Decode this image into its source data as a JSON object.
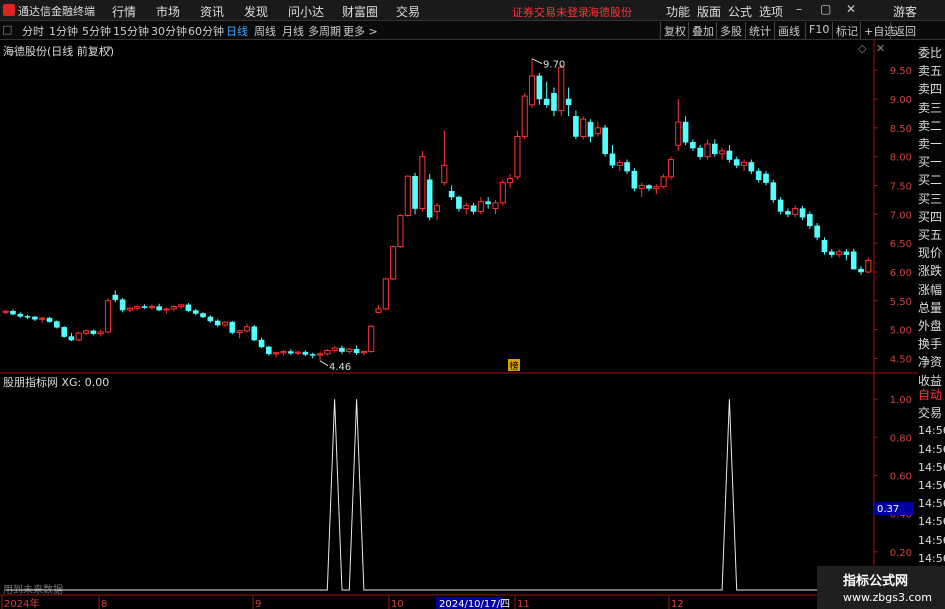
{
  "app": {
    "title": "通达信金融终端",
    "menus": [
      "行情",
      "市场",
      "资讯",
      "发现",
      "问小达",
      "财富圈",
      "交易"
    ],
    "warning": "证券交易未登录",
    "stock_name": "海德股份",
    "right_menus": [
      "功能",
      "版面",
      "公式",
      "选项"
    ],
    "user": "游客"
  },
  "toolbar": {
    "periods": [
      "分时",
      "1分钟",
      "5分钟",
      "15分钟",
      "30分钟",
      "60分钟",
      "日线",
      "周线",
      "月线",
      "多周期",
      "更多 >"
    ],
    "active": "日线",
    "right_buttons": [
      "复权",
      "叠加",
      "多股",
      "统计",
      "画线",
      "F10",
      "标记",
      "+自选",
      "返回"
    ]
  },
  "main_pane": {
    "title": "海德股份(日线 前复权)",
    "high_label": "9.70",
    "low_label": "4.46",
    "marker_label": "榜",
    "y_ticks": [
      "9.50",
      "9.00",
      "8.50",
      "8.00",
      "7.50",
      "7.00",
      "6.50",
      "6.00",
      "5.50",
      "5.00",
      "4.50"
    ]
  },
  "indicator_pane": {
    "title": "股朋指标网 XG: 0.00",
    "future_note": "用到未来数据",
    "y_ticks": [
      "1.00",
      "0.80",
      "0.60",
      "0.40",
      "0.20"
    ],
    "cursor_value": "0.37"
  },
  "x_axis": {
    "labels": [
      "2024年",
      "8",
      "9",
      "10",
      "2024/10/17/四",
      "11",
      "12"
    ]
  },
  "right_panel": {
    "quote_items": [
      "委比",
      "卖五",
      "卖四",
      "卖三",
      "卖二",
      "卖一",
      "买一",
      "买二",
      "买三",
      "买四",
      "买五",
      "现价",
      "涨跌",
      "涨幅",
      "总量",
      "外盘",
      "换手",
      "净资",
      "收益"
    ],
    "trade_items": [
      "自动",
      "交易",
      "14:56",
      "14:56",
      "14:56",
      "14:56",
      "14:56",
      "14:56",
      "14:56",
      "14:56"
    ]
  },
  "watermark": {
    "line1": "指标公式网",
    "line2": "www.zbgs3.com"
  },
  "chart_data": {
    "type": "candlestick",
    "title": "海德股份(日线 前复权)",
    "ylim": [
      4.3,
      9.85
    ],
    "bull_color": "#ff3232",
    "bear_color": "#54ffff",
    "candles": [
      [
        5.3,
        5.34,
        5.27,
        5.32
      ],
      [
        5.32,
        5.35,
        5.25,
        5.27
      ],
      [
        5.27,
        5.3,
        5.2,
        5.23
      ],
      [
        5.23,
        5.26,
        5.18,
        5.22
      ],
      [
        5.22,
        5.24,
        5.15,
        5.18
      ],
      [
        5.18,
        5.22,
        5.12,
        5.2
      ],
      [
        5.2,
        5.22,
        5.12,
        5.14
      ],
      [
        5.14,
        5.16,
        5.02,
        5.04
      ],
      [
        5.04,
        5.06,
        4.86,
        4.88
      ],
      [
        4.88,
        4.94,
        4.8,
        4.82
      ],
      [
        4.82,
        4.96,
        4.8,
        4.94
      ],
      [
        4.94,
        5.0,
        4.9,
        4.98
      ],
      [
        4.98,
        5.0,
        4.9,
        4.93
      ],
      [
        4.93,
        5.0,
        4.88,
        4.96
      ],
      [
        4.96,
        5.55,
        4.94,
        5.5
      ],
      [
        5.6,
        5.68,
        5.48,
        5.52
      ],
      [
        5.52,
        5.55,
        5.3,
        5.34
      ],
      [
        5.34,
        5.4,
        5.3,
        5.37
      ],
      [
        5.37,
        5.42,
        5.33,
        5.4
      ],
      [
        5.4,
        5.44,
        5.36,
        5.38
      ],
      [
        5.38,
        5.44,
        5.35,
        5.4
      ],
      [
        5.4,
        5.45,
        5.32,
        5.34
      ],
      [
        5.34,
        5.38,
        5.28,
        5.36
      ],
      [
        5.36,
        5.42,
        5.32,
        5.4
      ],
      [
        5.4,
        5.45,
        5.36,
        5.43
      ],
      [
        5.43,
        5.46,
        5.3,
        5.33
      ],
      [
        5.33,
        5.36,
        5.25,
        5.28
      ],
      [
        5.28,
        5.3,
        5.2,
        5.22
      ],
      [
        5.22,
        5.25,
        5.12,
        5.15
      ],
      [
        5.15,
        5.18,
        5.05,
        5.08
      ],
      [
        5.08,
        5.15,
        5.05,
        5.13
      ],
      [
        5.13,
        5.15,
        4.92,
        4.95
      ],
      [
        4.95,
        5.0,
        4.85,
        4.98
      ],
      [
        4.98,
        5.1,
        4.95,
        5.05
      ],
      [
        5.05,
        5.08,
        4.8,
        4.82
      ],
      [
        4.82,
        4.86,
        4.68,
        4.7
      ],
      [
        4.7,
        4.72,
        4.55,
        4.58
      ],
      [
        4.58,
        4.62,
        4.52,
        4.6
      ],
      [
        4.6,
        4.65,
        4.55,
        4.62
      ],
      [
        4.62,
        4.66,
        4.56,
        4.59
      ],
      [
        4.59,
        4.63,
        4.55,
        4.61
      ],
      [
        4.61,
        4.64,
        4.54,
        4.57
      ],
      [
        4.57,
        4.6,
        4.5,
        4.56
      ],
      [
        4.56,
        4.62,
        4.46,
        4.58
      ],
      [
        4.58,
        4.66,
        4.55,
        4.64
      ],
      [
        4.64,
        4.72,
        4.6,
        4.68
      ],
      [
        4.68,
        4.72,
        4.58,
        4.62
      ],
      [
        4.62,
        4.68,
        4.58,
        4.66
      ],
      [
        4.66,
        4.72,
        4.56,
        4.6
      ],
      [
        4.6,
        4.64,
        4.55,
        4.62
      ],
      [
        4.62,
        5.08,
        4.6,
        5.06
      ],
      [
        5.3,
        5.42,
        5.28,
        5.36
      ],
      [
        5.36,
        5.9,
        5.34,
        5.88
      ],
      [
        5.88,
        6.46,
        5.86,
        6.44
      ],
      [
        6.44,
        7.0,
        6.42,
        6.98
      ],
      [
        6.98,
        7.68,
        6.96,
        7.66
      ],
      [
        7.66,
        7.72,
        7.0,
        7.1
      ],
      [
        7.1,
        8.1,
        7.05,
        8.0
      ],
      [
        7.6,
        7.7,
        6.9,
        6.95
      ],
      [
        7.05,
        7.2,
        6.9,
        7.15
      ],
      [
        7.55,
        8.45,
        7.5,
        7.85
      ],
      [
        7.4,
        7.5,
        7.25,
        7.3
      ],
      [
        7.3,
        7.32,
        7.05,
        7.1
      ],
      [
        7.1,
        7.2,
        7.0,
        7.15
      ],
      [
        7.15,
        7.2,
        7.0,
        7.05
      ],
      [
        7.05,
        7.3,
        7.0,
        7.22
      ],
      [
        7.22,
        7.3,
        7.1,
        7.18
      ],
      [
        7.1,
        7.25,
        7.0,
        7.2
      ],
      [
        7.2,
        7.6,
        7.15,
        7.55
      ],
      [
        7.55,
        7.7,
        7.45,
        7.62
      ],
      [
        7.65,
        8.45,
        7.6,
        8.35
      ],
      [
        8.35,
        9.1,
        8.3,
        9.05
      ],
      [
        8.9,
        9.7,
        8.85,
        9.4
      ],
      [
        9.4,
        9.45,
        8.9,
        9.0
      ],
      [
        9.0,
        9.3,
        8.85,
        8.9
      ],
      [
        9.1,
        9.2,
        8.7,
        8.8
      ],
      [
        8.8,
        9.6,
        8.7,
        9.55
      ],
      [
        9.0,
        9.2,
        8.7,
        8.9
      ],
      [
        8.7,
        8.8,
        8.3,
        8.35
      ],
      [
        8.35,
        8.7,
        8.3,
        8.65
      ],
      [
        8.6,
        8.65,
        8.25,
        8.35
      ],
      [
        8.4,
        8.6,
        8.35,
        8.5
      ],
      [
        8.5,
        8.55,
        8.0,
        8.05
      ],
      [
        8.05,
        8.2,
        7.8,
        7.85
      ],
      [
        7.85,
        7.95,
        7.75,
        7.9
      ],
      [
        7.9,
        7.95,
        7.7,
        7.75
      ],
      [
        7.75,
        7.8,
        7.4,
        7.45
      ],
      [
        7.45,
        7.55,
        7.3,
        7.5
      ],
      [
        7.5,
        7.52,
        7.4,
        7.45
      ],
      [
        7.45,
        7.52,
        7.35,
        7.48
      ],
      [
        7.48,
        7.7,
        7.45,
        7.65
      ],
      [
        7.65,
        8.0,
        7.6,
        7.95
      ],
      [
        8.2,
        9.0,
        8.1,
        8.6
      ],
      [
        8.6,
        8.7,
        8.2,
        8.25
      ],
      [
        8.25,
        8.3,
        8.1,
        8.15
      ],
      [
        8.15,
        8.2,
        7.95,
        8.0
      ],
      [
        8.0,
        8.3,
        7.95,
        8.22
      ],
      [
        8.22,
        8.3,
        8.0,
        8.05
      ],
      [
        8.05,
        8.15,
        7.95,
        8.1
      ],
      [
        8.1,
        8.2,
        7.9,
        7.95
      ],
      [
        7.95,
        8.0,
        7.8,
        7.85
      ],
      [
        7.85,
        7.95,
        7.75,
        7.9
      ],
      [
        7.9,
        7.95,
        7.7,
        7.75
      ],
      [
        7.75,
        7.8,
        7.55,
        7.6
      ],
      [
        7.7,
        7.75,
        7.5,
        7.55
      ],
      [
        7.55,
        7.6,
        7.2,
        7.25
      ],
      [
        7.25,
        7.3,
        7.0,
        7.05
      ],
      [
        7.05,
        7.1,
        6.95,
        7.0
      ],
      [
        7.0,
        7.15,
        6.95,
        7.1
      ],
      [
        7.1,
        7.15,
        6.9,
        6.95
      ],
      [
        7.0,
        7.05,
        6.75,
        6.8
      ],
      [
        6.8,
        6.85,
        6.55,
        6.6
      ],
      [
        6.55,
        6.6,
        6.3,
        6.35
      ],
      [
        6.35,
        6.4,
        6.25,
        6.3
      ],
      [
        6.3,
        6.4,
        6.25,
        6.35
      ],
      [
        6.35,
        6.4,
        6.2,
        6.3
      ],
      [
        6.35,
        6.4,
        6.1,
        6.05
      ],
      [
        6.05,
        6.1,
        5.95,
        6.0
      ],
      [
        6.0,
        6.25,
        5.98,
        6.2
      ]
    ],
    "signals": [
      {
        "index": 45,
        "value": 1.0
      },
      {
        "index": 48,
        "value": 1.0
      },
      {
        "index": 99,
        "value": 1.0
      },
      {
        "index": 132,
        "value": 1.0
      }
    ],
    "signal_ylim": [
      0,
      1.1
    ]
  }
}
